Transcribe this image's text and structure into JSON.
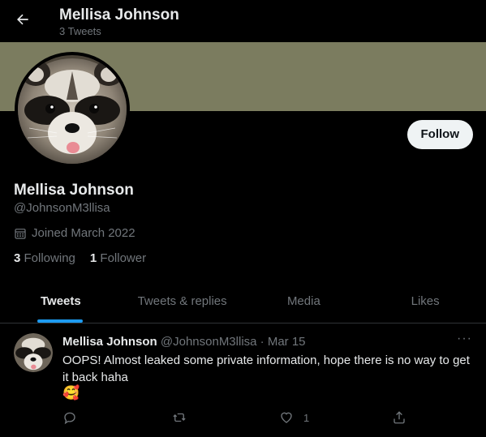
{
  "header": {
    "title": "Mellisa Johnson",
    "tweet_count": "3 Tweets"
  },
  "colors": {
    "banner": "#7b7c5f",
    "accent": "#1d9bf0",
    "background": "#000000"
  },
  "profile": {
    "name": "Mellisa Johnson",
    "handle": "@JohnsonM3llisa",
    "joined": "Joined March 2022",
    "following_count": "3",
    "following_label": "Following",
    "followers_count": "1",
    "followers_label": "Follower",
    "follow_label": "Follow"
  },
  "tabs": [
    {
      "label": "Tweets",
      "active": true
    },
    {
      "label": "Tweets & replies",
      "active": false
    },
    {
      "label": "Media",
      "active": false
    },
    {
      "label": "Likes",
      "active": false
    }
  ],
  "tweet": {
    "name": "Mellisa Johnson",
    "meta": "@JohnsonM3llisa · Mar 15",
    "text": "OOPS! Almost leaked some private information, hope there is no way to get it back haha",
    "emoji": "🥰",
    "like_count": "1"
  },
  "icons": {
    "back": "arrow-left-icon",
    "calendar": "calendar-icon",
    "more": "more-icon",
    "reply": "reply-icon",
    "retweet": "retweet-icon",
    "like": "heart-icon",
    "share": "share-icon"
  }
}
